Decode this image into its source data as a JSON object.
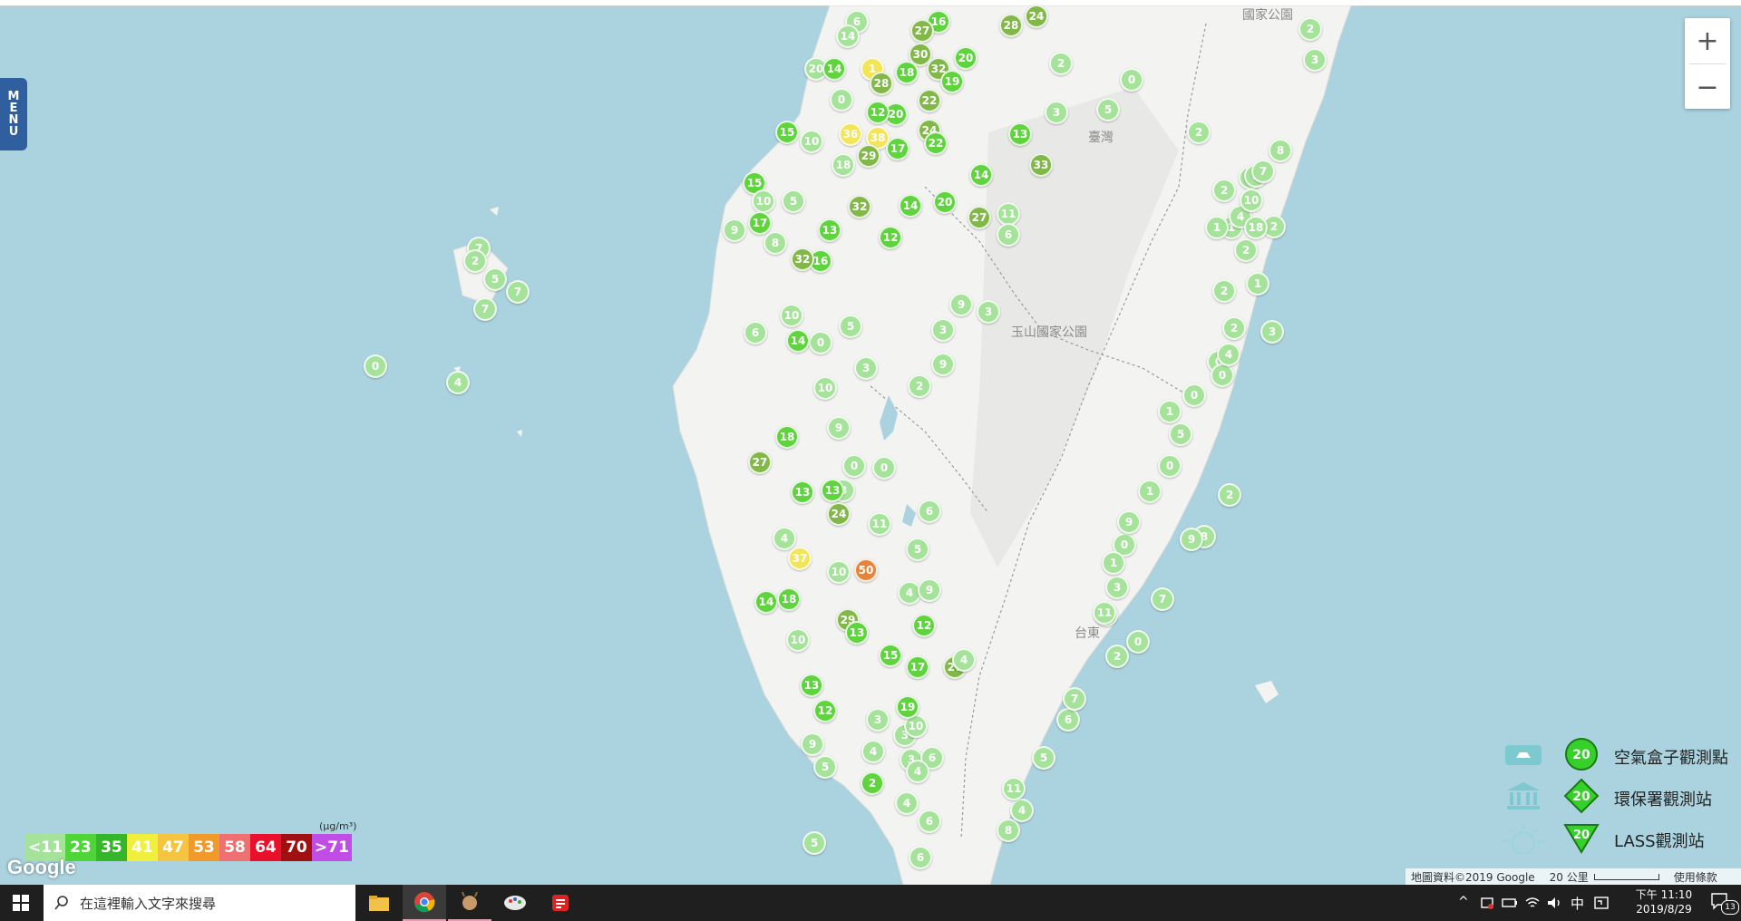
{
  "menu": {
    "label": "MENU",
    "letters": [
      "M",
      "E",
      "N",
      "U"
    ]
  },
  "zoom": {
    "in_label": "+",
    "out_label": "−"
  },
  "map_labels": [
    {
      "text": "國家公園"
    },
    {
      "text": "臺灣"
    },
    {
      "text": "玉山國家公園"
    },
    {
      "text": "台東"
    }
  ],
  "colors": {
    "water": "#aad3df",
    "land": "#f3f3f1",
    "level1": "#a6e39a",
    "level2": "#5fd43f",
    "level3": "#82b84a",
    "level4": "#f3e55a",
    "level5": "#e8843a"
  },
  "markers": [
    {
      "v": "6",
      "c": "l1"
    },
    {
      "v": "16",
      "c": "l2"
    },
    {
      "v": "28",
      "c": "l3"
    },
    {
      "v": "24",
      "c": "l3"
    },
    {
      "v": "27",
      "c": "l3"
    },
    {
      "v": "14",
      "c": "l1"
    },
    {
      "v": "20",
      "c": "l2"
    },
    {
      "v": "30",
      "c": "l3"
    },
    {
      "v": "32",
      "c": "l3"
    },
    {
      "v": "19",
      "c": "l2"
    },
    {
      "v": "20",
      "c": "l1"
    },
    {
      "v": "14",
      "c": "l2"
    },
    {
      "v": "1",
      "c": "l4"
    },
    {
      "v": "28",
      "c": "l3"
    },
    {
      "v": "18",
      "c": "l2"
    },
    {
      "v": "22",
      "c": "l3"
    },
    {
      "v": "20",
      "c": "l2"
    },
    {
      "v": "12",
      "c": "l2"
    },
    {
      "v": "0",
      "c": "l1"
    },
    {
      "v": "2",
      "c": "l1"
    },
    {
      "v": "0",
      "c": "l1"
    },
    {
      "v": "5",
      "c": "l1"
    },
    {
      "v": "3",
      "c": "l1"
    },
    {
      "v": "13",
      "c": "l2"
    },
    {
      "v": "15",
      "c": "l2"
    },
    {
      "v": "10",
      "c": "l1"
    },
    {
      "v": "36",
      "c": "l4"
    },
    {
      "v": "38",
      "c": "l4"
    },
    {
      "v": "29",
      "c": "l3"
    },
    {
      "v": "17",
      "c": "l2"
    },
    {
      "v": "24",
      "c": "l3"
    },
    {
      "v": "22",
      "c": "l2"
    },
    {
      "v": "18",
      "c": "l1"
    },
    {
      "v": "33",
      "c": "l3"
    },
    {
      "v": "14",
      "c": "l2"
    },
    {
      "v": "15",
      "c": "l2"
    },
    {
      "v": "32",
      "c": "l3"
    },
    {
      "v": "20",
      "c": "l2"
    },
    {
      "v": "14",
      "c": "l2"
    },
    {
      "v": "27",
      "c": "l3"
    },
    {
      "v": "11",
      "c": "l1"
    },
    {
      "v": "6",
      "c": "l1"
    },
    {
      "v": "10",
      "c": "l1"
    },
    {
      "v": "5",
      "c": "l1"
    },
    {
      "v": "17",
      "c": "l2"
    },
    {
      "v": "13",
      "c": "l2"
    },
    {
      "v": "9",
      "c": "l1"
    },
    {
      "v": "16",
      "c": "l2"
    },
    {
      "v": "32",
      "c": "l3"
    },
    {
      "v": "12",
      "c": "l2"
    },
    {
      "v": "8",
      "c": "l1"
    },
    {
      "v": "7",
      "c": "l1"
    },
    {
      "v": "2",
      "c": "l1"
    },
    {
      "v": "5",
      "c": "l1"
    },
    {
      "v": "7",
      "c": "l1"
    },
    {
      "v": "7",
      "c": "l1"
    },
    {
      "v": "0",
      "c": "l1"
    },
    {
      "v": "4",
      "c": "l1"
    },
    {
      "v": "6",
      "c": "l1"
    },
    {
      "v": "10",
      "c": "l1"
    },
    {
      "v": "5",
      "c": "l1"
    },
    {
      "v": "0",
      "c": "l1"
    },
    {
      "v": "3",
      "c": "l1"
    },
    {
      "v": "9",
      "c": "l1"
    },
    {
      "v": "9",
      "c": "l1"
    },
    {
      "v": "3",
      "c": "l1"
    },
    {
      "v": "3",
      "c": "l1"
    },
    {
      "v": "14",
      "c": "l2"
    },
    {
      "v": "27",
      "c": "l3"
    },
    {
      "v": "2",
      "c": "l1"
    },
    {
      "v": "0",
      "c": "l1"
    },
    {
      "v": "10",
      "c": "l1"
    },
    {
      "v": "18",
      "c": "l2"
    },
    {
      "v": "4",
      "c": "l1"
    },
    {
      "v": "13",
      "c": "l2"
    },
    {
      "v": "9",
      "c": "l1"
    },
    {
      "v": "8",
      "c": "l1"
    },
    {
      "v": "6",
      "c": "l1"
    },
    {
      "v": "0",
      "c": "l1"
    },
    {
      "v": "24",
      "c": "l3"
    },
    {
      "v": "11",
      "c": "l1"
    },
    {
      "v": "13",
      "c": "l2"
    },
    {
      "v": "37",
      "c": "l4"
    },
    {
      "v": "50",
      "c": "l5"
    },
    {
      "v": "10",
      "c": "l1"
    },
    {
      "v": "5",
      "c": "l1"
    },
    {
      "v": "4",
      "c": "l1"
    },
    {
      "v": "9",
      "c": "l1"
    },
    {
      "v": "14",
      "c": "l2"
    },
    {
      "v": "18",
      "c": "l2"
    },
    {
      "v": "12",
      "c": "l2"
    },
    {
      "v": "29",
      "c": "l3"
    },
    {
      "v": "13",
      "c": "l2"
    },
    {
      "v": "15",
      "c": "l2"
    },
    {
      "v": "10",
      "c": "l1"
    },
    {
      "v": "3",
      "c": "l1"
    },
    {
      "v": "17",
      "c": "l2"
    },
    {
      "v": "13",
      "c": "l2"
    },
    {
      "v": "12",
      "c": "l2"
    },
    {
      "v": "3",
      "c": "l1"
    },
    {
      "v": "10",
      "c": "l1"
    },
    {
      "v": "27",
      "c": "l3"
    },
    {
      "v": "19",
      "c": "l2"
    },
    {
      "v": "9",
      "c": "l1"
    },
    {
      "v": "4",
      "c": "l1"
    },
    {
      "v": "3",
      "c": "l1"
    },
    {
      "v": "6",
      "c": "l1"
    },
    {
      "v": "2",
      "c": "l2"
    },
    {
      "v": "5",
      "c": "l1"
    },
    {
      "v": "4",
      "c": "l1"
    },
    {
      "v": "4",
      "c": "l1"
    },
    {
      "v": "6",
      "c": "l1"
    },
    {
      "v": "6",
      "c": "l1"
    },
    {
      "v": "5",
      "c": "l1"
    },
    {
      "v": "4",
      "c": "l1"
    },
    {
      "v": "8",
      "c": "l1"
    },
    {
      "v": "4",
      "c": "l1"
    },
    {
      "v": "11",
      "c": "l1"
    },
    {
      "v": "5",
      "c": "l1"
    },
    {
      "v": "6",
      "c": "l1"
    },
    {
      "v": "7",
      "c": "l1"
    },
    {
      "v": "2",
      "c": "l1"
    },
    {
      "v": "11",
      "c": "l1"
    },
    {
      "v": "0",
      "c": "l1"
    },
    {
      "v": "2",
      "c": "l1"
    },
    {
      "v": "7",
      "c": "l1"
    },
    {
      "v": "3",
      "c": "l1"
    },
    {
      "v": "0",
      "c": "l1"
    },
    {
      "v": "1",
      "c": "l1"
    },
    {
      "v": "9",
      "c": "l1"
    },
    {
      "v": "8",
      "c": "l1"
    },
    {
      "v": "9",
      "c": "l1"
    },
    {
      "v": "0",
      "c": "l1"
    },
    {
      "v": "1",
      "c": "l1"
    },
    {
      "v": "2",
      "c": "l1"
    },
    {
      "v": "1",
      "c": "l1"
    },
    {
      "v": "5",
      "c": "l1"
    },
    {
      "v": "0",
      "c": "l1"
    },
    {
      "v": "0",
      "c": "l1"
    },
    {
      "v": "0",
      "c": "l1"
    },
    {
      "v": "2",
      "c": "l1"
    },
    {
      "v": "4",
      "c": "l1"
    },
    {
      "v": "3",
      "c": "l1"
    },
    {
      "v": "1",
      "c": "l1"
    },
    {
      "v": "2",
      "c": "l1"
    },
    {
      "v": "2",
      "c": "l1"
    },
    {
      "v": "2",
      "c": "l1"
    },
    {
      "v": "1",
      "c": "l1"
    },
    {
      "v": "2",
      "c": "l1"
    },
    {
      "v": "6",
      "c": "l1"
    },
    {
      "v": "2",
      "c": "l1"
    },
    {
      "v": "1",
      "c": "l1"
    },
    {
      "v": "4",
      "c": "l1"
    },
    {
      "v": "3",
      "c": "l1"
    },
    {
      "v": "2",
      "c": "l1"
    },
    {
      "v": "3",
      "c": "l1"
    },
    {
      "v": "8",
      "c": "l1"
    },
    {
      "v": "7",
      "c": "l1"
    },
    {
      "v": "10",
      "c": "l1"
    },
    {
      "v": "18",
      "c": "l1"
    }
  ],
  "scale": {
    "unit": "(μg/m³)",
    "items": [
      {
        "label": "<11",
        "color": "#a6e39a"
      },
      {
        "label": "23",
        "color": "#4ed639"
      },
      {
        "label": "35",
        "color": "#35b52a"
      },
      {
        "label": "41",
        "color": "#f0f03c"
      },
      {
        "label": "47",
        "color": "#f5c542"
      },
      {
        "label": "53",
        "color": "#ef9a2a"
      },
      {
        "label": "58",
        "color": "#ef7070"
      },
      {
        "label": "64",
        "color": "#e8102a"
      },
      {
        "label": "70",
        "color": "#a01010"
      },
      {
        "label": ">71",
        "color": "#c04ee6"
      }
    ]
  },
  "legend": [
    {
      "label": "空氣盒子觀測點",
      "badge": "20"
    },
    {
      "label": "環保署觀測站",
      "badge": "20"
    },
    {
      "label": "LASS觀測站",
      "badge": "20"
    }
  ],
  "google_logo": "Google",
  "attribution": {
    "data": "地圖資料©2019 Google",
    "scale": "20 公里",
    "terms": "使用條款"
  },
  "taskbar": {
    "search_placeholder": "在這裡輸入文字來搜尋",
    "ime": "中",
    "time": "下午 11:10",
    "date": "2019/8/29",
    "notifications": "13"
  }
}
